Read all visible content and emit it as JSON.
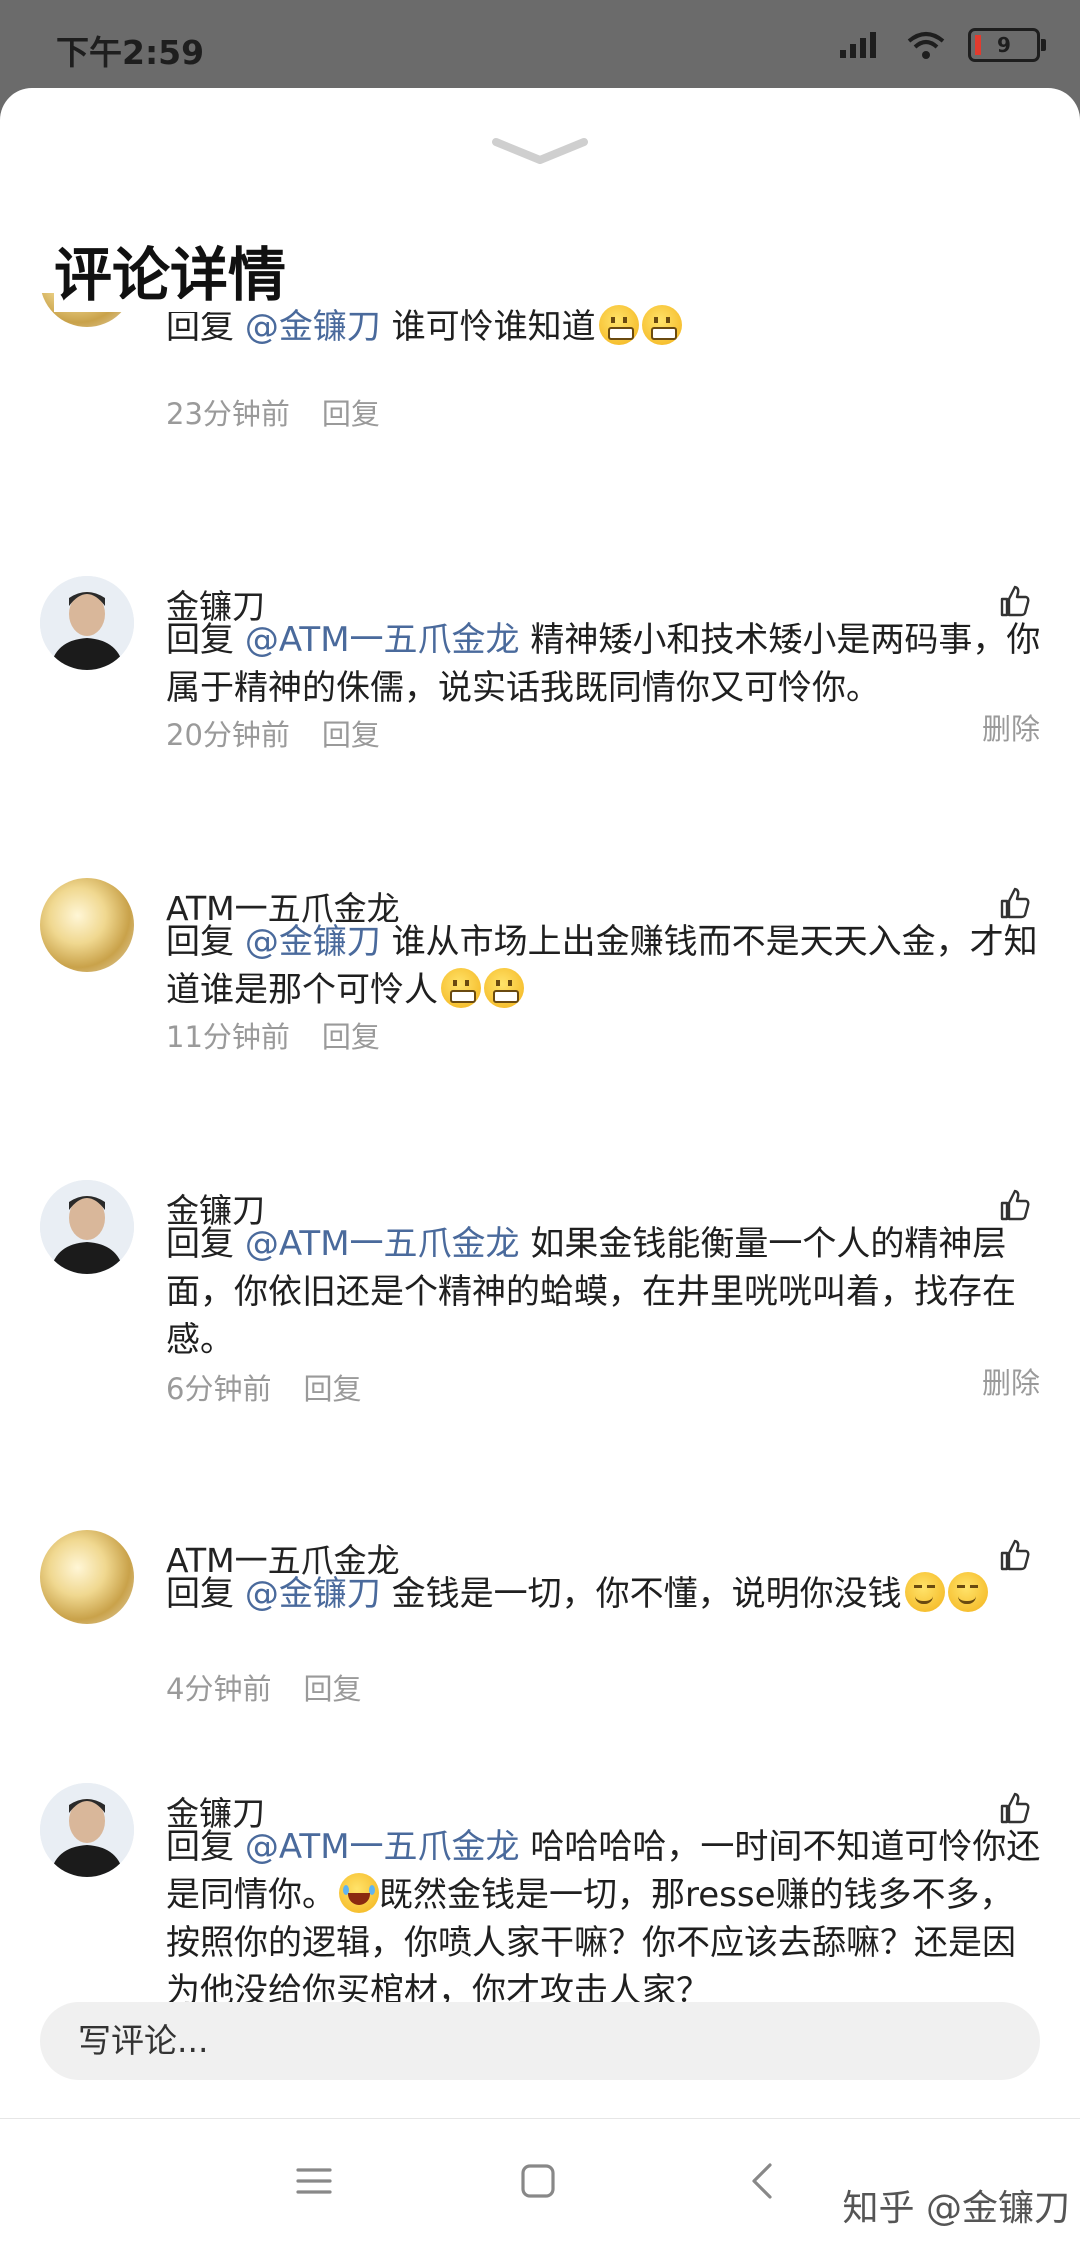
{
  "status": {
    "time": "下午2:59",
    "battery_level": "9"
  },
  "sheet": {
    "title": "评论详情"
  },
  "comments": [
    {
      "name": "",
      "avatar": "gold",
      "reply_prefix": "回复",
      "mention": "@金镰刀",
      "text": " 谁可怜谁知道",
      "emojis": [
        "grimace",
        "grimace"
      ],
      "time": "23分钟前",
      "reply": "回复",
      "delete": ""
    },
    {
      "name": "金镰刀",
      "avatar": "man",
      "reply_prefix": "回复",
      "mention": "@ATM一五爪金龙",
      "text": " 精神矮小和技术矮小是两码事，你属于精神的侏儒，说实话我既同情你又可怜你。",
      "time": "20分钟前",
      "reply": "回复",
      "delete": "删除"
    },
    {
      "name": "ATM一五爪金龙",
      "avatar": "gold",
      "reply_prefix": "回复",
      "mention": "@金镰刀",
      "text": " 谁从市场上出金赚钱而不是天天入金，才知道谁是那个可怜人",
      "emojis": [
        "grimace",
        "grimace"
      ],
      "time": "11分钟前",
      "reply": "回复",
      "delete": ""
    },
    {
      "name": "金镰刀",
      "avatar": "man",
      "reply_prefix": "回复",
      "mention": "@ATM一五爪金龙",
      "text": " 如果金钱能衡量一个人的精神层面，你依旧还是个精神的蛤蟆，在井里咣咣叫着，找存在感。",
      "time": "6分钟前",
      "reply": "回复",
      "delete": "删除"
    },
    {
      "name": "ATM一五爪金龙",
      "avatar": "gold",
      "reply_prefix": "回复",
      "mention": "@金镰刀",
      "text": " 金钱是一切，你不懂，说明你没钱",
      "emojis": [
        "smirk",
        "smirk"
      ],
      "time": "4分钟前",
      "reply": "回复",
      "delete": ""
    },
    {
      "name": "金镰刀",
      "avatar": "man",
      "reply_prefix": "回复",
      "mention": "@ATM一五爪金龙",
      "text": " 哈哈哈哈，一时间不知道可怜你还是同情你。",
      "text2": "既然金钱是一切，那resse赚的钱多不多，按照你的逻辑，你喷人家干嘛？你不应该去舔嘛？还是因为他没给你买棺材，你才攻击人家？",
      "time": "",
      "reply": "",
      "delete": ""
    }
  ],
  "input": {
    "placeholder": "写评论..."
  },
  "watermark": "知乎 @金镰刀",
  "colors": {
    "mention": "#4a6a9c",
    "meta": "#9a9a9a"
  }
}
